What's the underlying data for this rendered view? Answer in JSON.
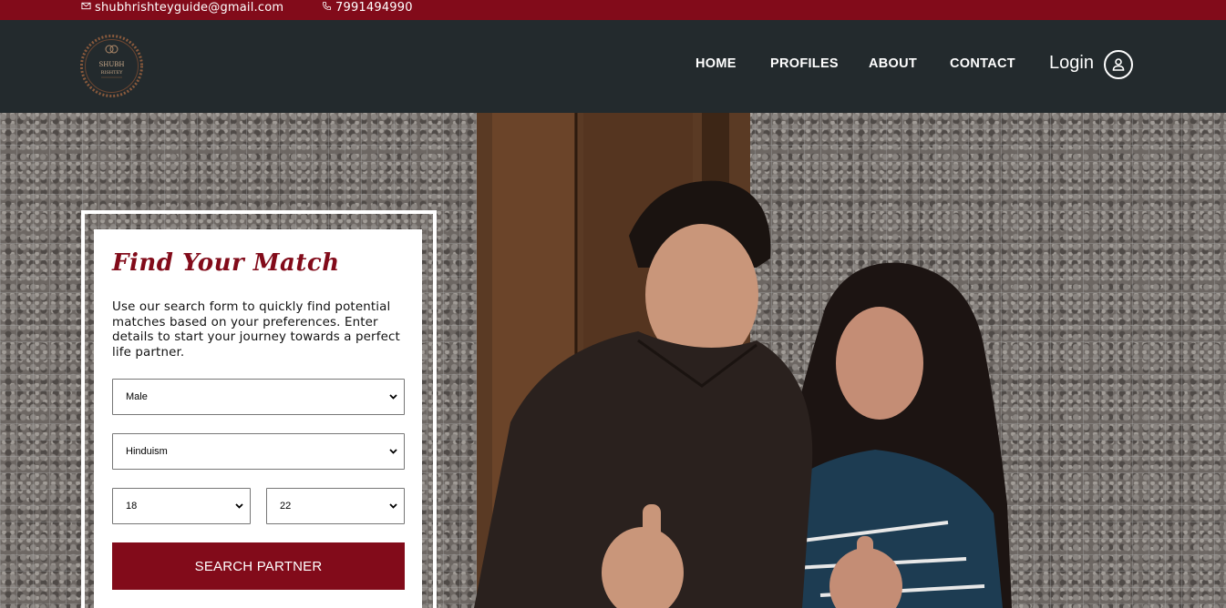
{
  "topbar": {
    "email": "shubhrishteyguide@gmail.com",
    "phone": "7991494990"
  },
  "brand": {
    "logo_line1": "SHUBH",
    "logo_line2": "RISHTEY"
  },
  "nav": {
    "items": [
      {
        "label": "HOME"
      },
      {
        "label": "PROFILES"
      },
      {
        "label": "ABOUT"
      },
      {
        "label": "CONTACT"
      }
    ],
    "login_label": "Login"
  },
  "search": {
    "title": "Find Your Match",
    "description": "Use our search form to quickly find potential matches based on your preferences. Enter details to start your journey towards a perfect life partner.",
    "gender": "Male",
    "religion": "Hinduism",
    "age_from": "18",
    "age_to": "22",
    "button_label": "SEARCH PARTNER"
  },
  "colors": {
    "brand": "#820b1a",
    "nav_bg": "#232a2d"
  }
}
